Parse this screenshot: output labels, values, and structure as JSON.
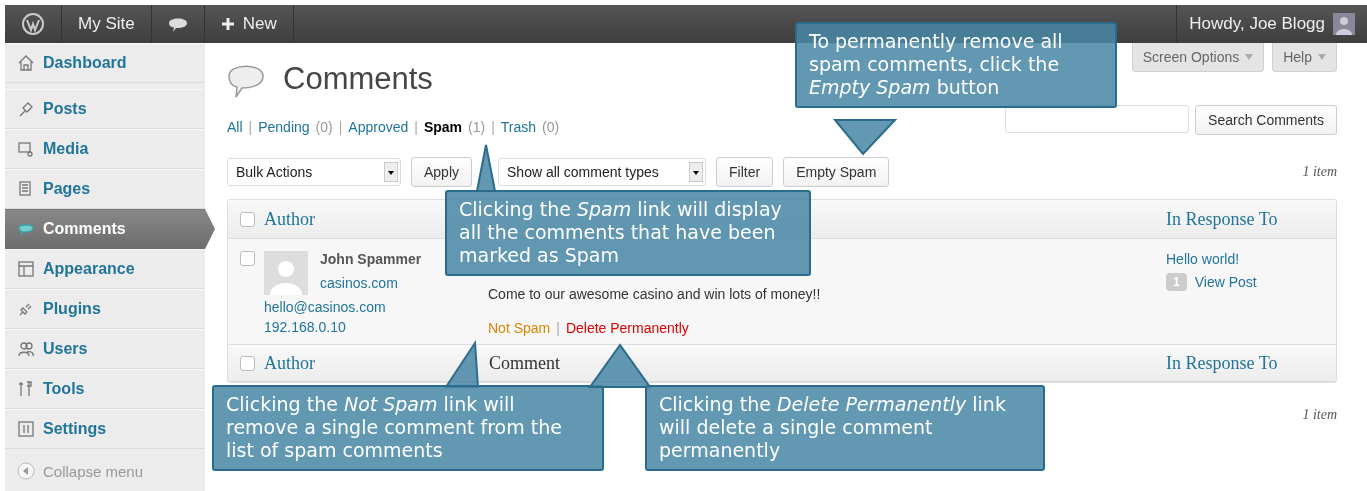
{
  "admin_bar": {
    "items": [
      {
        "kind": "logo"
      },
      {
        "kind": "site",
        "label": "My Site"
      },
      {
        "kind": "comments"
      },
      {
        "kind": "new",
        "label": "New"
      }
    ],
    "greeting": "Howdy, Joe Blogg"
  },
  "sidebar": {
    "items": [
      {
        "label": "Dashboard",
        "selected": false
      },
      {
        "label": "Posts",
        "selected": false
      },
      {
        "label": "Media",
        "selected": false
      },
      {
        "label": "Pages",
        "selected": false
      },
      {
        "label": "Comments",
        "selected": true
      },
      {
        "label": "Appearance",
        "selected": false
      },
      {
        "label": "Plugins",
        "selected": false
      },
      {
        "label": "Users",
        "selected": false
      },
      {
        "label": "Tools",
        "selected": false
      },
      {
        "label": "Settings",
        "selected": false
      }
    ],
    "collapse": "Collapse menu"
  },
  "page": {
    "title": "Comments",
    "screen_tabs": [
      "Screen Options",
      "Help"
    ],
    "filters": [
      {
        "label": "All",
        "selected": false
      },
      {
        "separator": "|",
        "label": "Pending",
        "count": "(0)",
        "selected": false
      },
      {
        "separator": "|",
        "label": "Approved",
        "selected": false
      },
      {
        "separator": "|",
        "label": "Spam",
        "count": "(1)",
        "selected": true
      },
      {
        "separator": "|",
        "label": "Trash",
        "count": "(0)",
        "selected": false
      }
    ],
    "search_button": "Search Comments",
    "tablenav": {
      "bulk_actions": "Bulk Actions",
      "apply": "Apply",
      "type_filter": "Show all comment types",
      "filter": "Filter",
      "empty_spam": "Empty Spam",
      "item_count": "1 item"
    },
    "header_checked": false,
    "header_columns": [
      "Author",
      "In Response To"
    ],
    "rows": [
      {
        "checked": false,
        "author": "John Spammer",
        "site": "casinos.com",
        "email": "hello@casinos.com",
        "ip": "192.168.0.10",
        "text": "Come to our awesome casino and win lots of money!!",
        "actions": [
          {
            "label": "Not Spam",
            "kind": "unspam"
          },
          {
            "separator": "|",
            "label": "Delete Permanently",
            "kind": "delete"
          }
        ],
        "post": "Hello world!",
        "comment_count": "1",
        "view_post": "View Post"
      }
    ],
    "footer_checked": false,
    "footer_columns": [
      "Author",
      "Comment",
      "In Response To"
    ],
    "bottom_item_count": "1 item"
  },
  "callouts": [
    "To permanently remove all spam comments, click the *Empty Spam* button",
    "Clicking the *Spam* link will display all the comments that have been marked as Spam",
    "Clicking the *Not Spam* link will remove a single comment from the list of spam comments",
    "Clicking the *Delete Permanently* link will delete a single comment permanently"
  ]
}
